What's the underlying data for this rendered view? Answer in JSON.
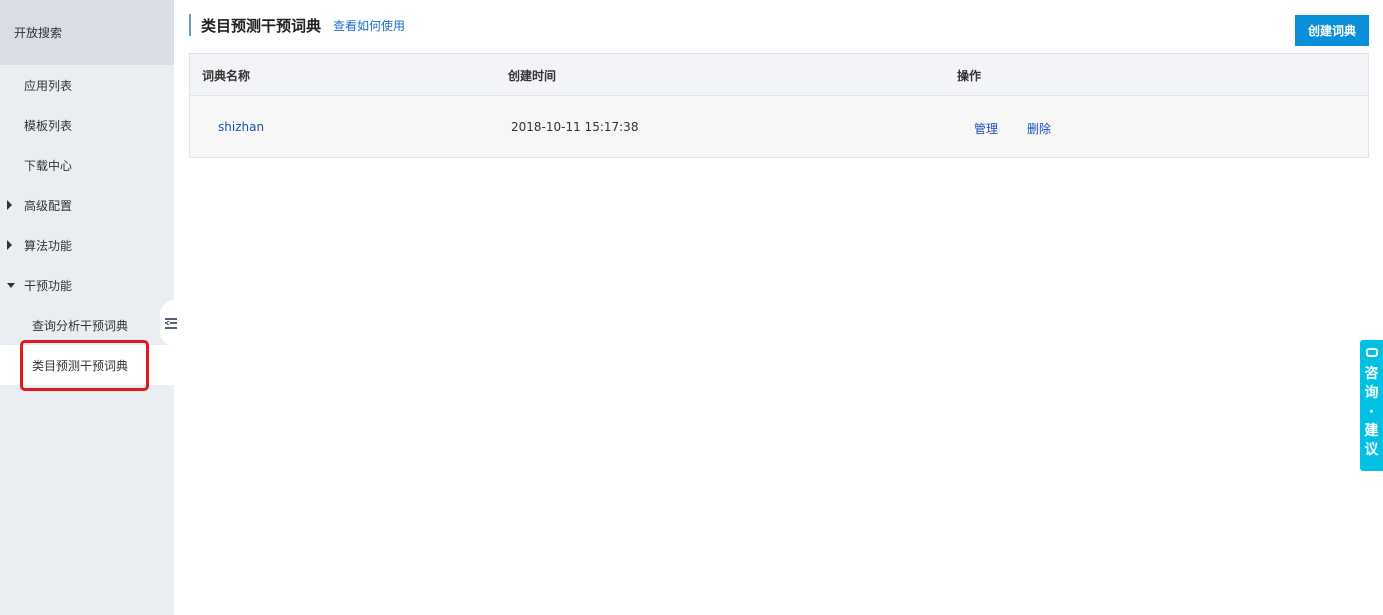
{
  "sidebar": {
    "title": "开放搜索",
    "items": [
      {
        "label": "应用列表"
      },
      {
        "label": "模板列表"
      },
      {
        "label": "下载中心"
      },
      {
        "label": "高级配置"
      },
      {
        "label": "算法功能"
      },
      {
        "label": "干预功能"
      },
      {
        "label": "查询分析干预词典"
      },
      {
        "label": "类目预测干预词典"
      }
    ]
  },
  "header": {
    "title": "类目预测干预词典",
    "help_link": "查看如何使用",
    "create_button": "创建词典"
  },
  "table": {
    "columns": [
      "词典名称",
      "创建时间",
      "操作"
    ],
    "rows": [
      {
        "name": "shizhan",
        "created": "2018-10-11 15:17:38",
        "manage": "管理",
        "delete": "删除"
      }
    ]
  },
  "float_button": {
    "label": "咨询·建议",
    "icon": "chat-icon"
  },
  "colors": {
    "primary_button": "#0b8fd8",
    "link": "#1e4fb5",
    "highlight": "#e0191e",
    "consult": "#00c1e4"
  }
}
